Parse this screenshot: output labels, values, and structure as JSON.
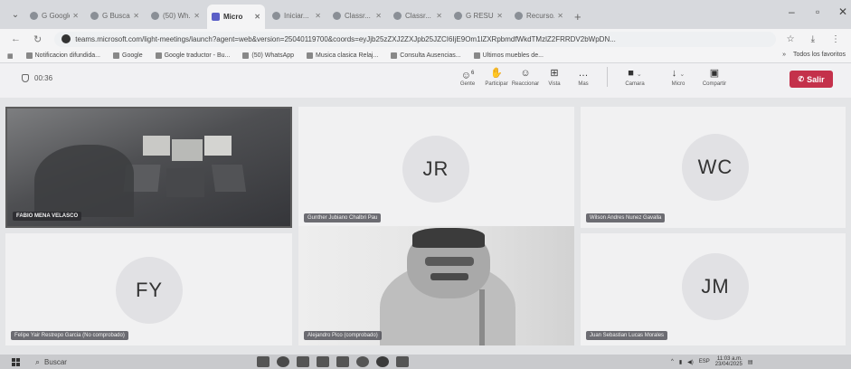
{
  "browser": {
    "tabs": [
      {
        "label": "G Google",
        "active": false
      },
      {
        "label": "G Buscar...",
        "active": false
      },
      {
        "label": "(50) Wh...",
        "active": false
      },
      {
        "label": "Micro",
        "active": true
      },
      {
        "label": "Iniciar...",
        "active": false
      },
      {
        "label": "Classr...",
        "active": false
      },
      {
        "label": "Classr...",
        "active": false
      },
      {
        "label": "G RESUMEN",
        "active": false
      },
      {
        "label": "Recurso...",
        "active": false
      }
    ],
    "url": "teams.microsoft.com/light-meetings/launch?agent=web&version=25040119700&coords=eyJjb25zZXJ2ZXJpb25JZCI6IjE9Om1lZXRpbmdfWkdTMzlZ2FRRDV2bWpDN...",
    "bookmarks": [
      "Notificacion difundida...",
      "Google",
      "Google traductor - Bu...",
      "(50) WhatsApp",
      "Musica clasica Relaj...",
      "Consulta Ausencias...",
      "Ultimos muebles de..."
    ],
    "bookmarks_right": "Todos los favoritos"
  },
  "meeting": {
    "timer": "00:36",
    "controls": [
      {
        "icon": "people-icon",
        "glyph": "☺",
        "label": "Gente",
        "badge": "6"
      },
      {
        "icon": "raise-hand-icon",
        "glyph": "✋",
        "label": "Participar"
      },
      {
        "icon": "react-icon",
        "glyph": "☺",
        "label": "Reaccionar"
      },
      {
        "icon": "view-icon",
        "glyph": "⊞",
        "label": "Vista"
      },
      {
        "icon": "more-icon",
        "glyph": "…",
        "label": "Mas"
      }
    ],
    "media": [
      {
        "icon": "camera-icon",
        "glyph": "■",
        "label": "Camara"
      },
      {
        "icon": "mic-icon",
        "glyph": "↓",
        "label": "Micro"
      },
      {
        "icon": "share-icon",
        "glyph": "▣",
        "label": "Compartir"
      }
    ],
    "leave_label": "Salir"
  },
  "participants": [
    {
      "name": "FABIO MENA VELASCO",
      "initials": "",
      "video": true
    },
    {
      "name": "Gunther Jubiano Chalbri Pau",
      "initials": "JR",
      "video": false
    },
    {
      "name": "Wilson Andres Nunez Gavalla",
      "initials": "WC",
      "video": false
    },
    {
      "name": "Felipe Yair Restrepo Garcia (No comprobado)",
      "initials": "FY",
      "video": false
    },
    {
      "name": "Alejandro Pico (comprobado)",
      "initials": "",
      "video": true
    },
    {
      "name": "Juan Sebastian Lucas Morales",
      "initials": "JM",
      "video": false
    }
  ],
  "taskbar": {
    "search_placeholder": "Buscar",
    "time": "11:03 a.m.",
    "date": "23/04/2025"
  }
}
